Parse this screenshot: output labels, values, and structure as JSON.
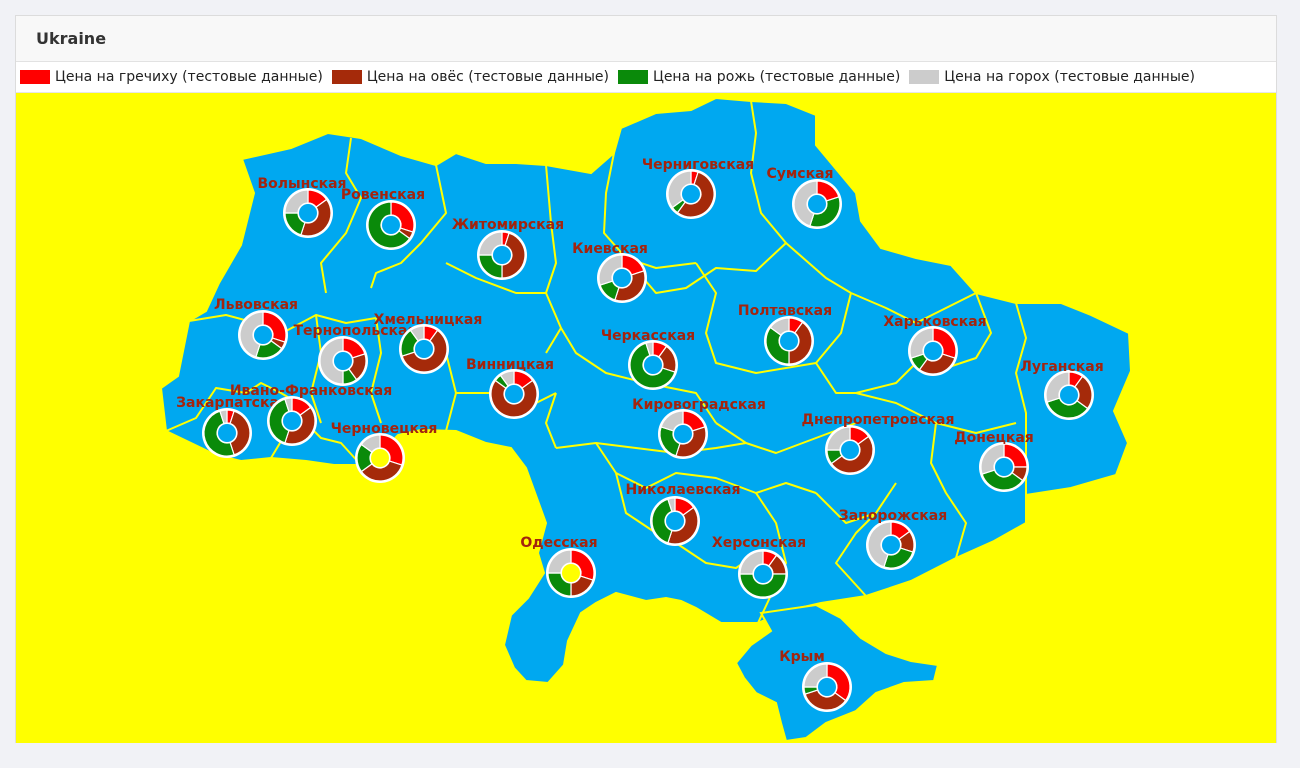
{
  "panel": {
    "title": "Ukraine"
  },
  "legend": [
    {
      "label": "Цена на гречиху (тестовые данные)",
      "color": "#ff0000"
    },
    {
      "label": "Цена на овёс (тестовые данные)",
      "color": "#a52a0a"
    },
    {
      "label": "Цена на рожь (тестовые данные)",
      "color": "#0a8a0a"
    },
    {
      "label": "Цена на горох (тестовые данные)",
      "color": "#cccccc"
    }
  ],
  "map": {
    "background_color": "#ffff00",
    "land_color": "#00a8f0",
    "border_color": "#ffff00",
    "label_color": "#a3240e"
  },
  "chart_data": {
    "type": "pie",
    "variant": "donut-per-region",
    "series_names": [
      "Цена на гречиху (тестовые данные)",
      "Цена на овёс (тестовые данные)",
      "Цена на рожь (тестовые данные)",
      "Цена на горох (тестовые данные)"
    ],
    "regions": [
      {
        "name": "Волынская",
        "values": [
          15,
          40,
          20,
          25
        ]
      },
      {
        "name": "Ровенская",
        "values": [
          30,
          5,
          65,
          0
        ]
      },
      {
        "name": "Житомирская",
        "values": [
          5,
          45,
          25,
          25
        ]
      },
      {
        "name": "Черниговская",
        "values": [
          5,
          55,
          5,
          35
        ]
      },
      {
        "name": "Сумская",
        "values": [
          20,
          0,
          35,
          45
        ]
      },
      {
        "name": "Киевская",
        "values": [
          20,
          35,
          15,
          30
        ]
      },
      {
        "name": "Львовская",
        "values": [
          30,
          5,
          20,
          45
        ]
      },
      {
        "name": "Тернопольская",
        "values": [
          20,
          20,
          10,
          50
        ]
      },
      {
        "name": "Хмельницкая",
        "values": [
          10,
          60,
          20,
          10
        ]
      },
      {
        "name": "Винницкая",
        "values": [
          15,
          70,
          5,
          10
        ]
      },
      {
        "name": "Черкасская",
        "values": [
          10,
          20,
          65,
          5
        ]
      },
      {
        "name": "Полтавская",
        "values": [
          10,
          40,
          35,
          15
        ]
      },
      {
        "name": "Харьковская",
        "values": [
          30,
          30,
          10,
          30
        ]
      },
      {
        "name": "Луганская",
        "values": [
          10,
          25,
          35,
          30
        ]
      },
      {
        "name": "Закарпатская",
        "values": [
          5,
          40,
          50,
          5
        ]
      },
      {
        "name": "Ивано-Франковская",
        "values": [
          15,
          40,
          40,
          5
        ]
      },
      {
        "name": "Черновецкая",
        "values": [
          30,
          35,
          20,
          15
        ]
      },
      {
        "name": "Кировоградская",
        "values": [
          20,
          35,
          25,
          20
        ]
      },
      {
        "name": "Днепропетровская",
        "values": [
          15,
          50,
          10,
          25
        ]
      },
      {
        "name": "Донецкая",
        "values": [
          25,
          10,
          35,
          30
        ]
      },
      {
        "name": "Николаевская",
        "values": [
          15,
          40,
          40,
          5
        ]
      },
      {
        "name": "Одесская",
        "values": [
          30,
          20,
          25,
          25
        ]
      },
      {
        "name": "Херсонская",
        "values": [
          10,
          15,
          50,
          25
        ]
      },
      {
        "name": "Запорожская",
        "values": [
          15,
          15,
          25,
          45
        ]
      },
      {
        "name": "Крым",
        "values": [
          35,
          35,
          5,
          25
        ]
      }
    ]
  }
}
